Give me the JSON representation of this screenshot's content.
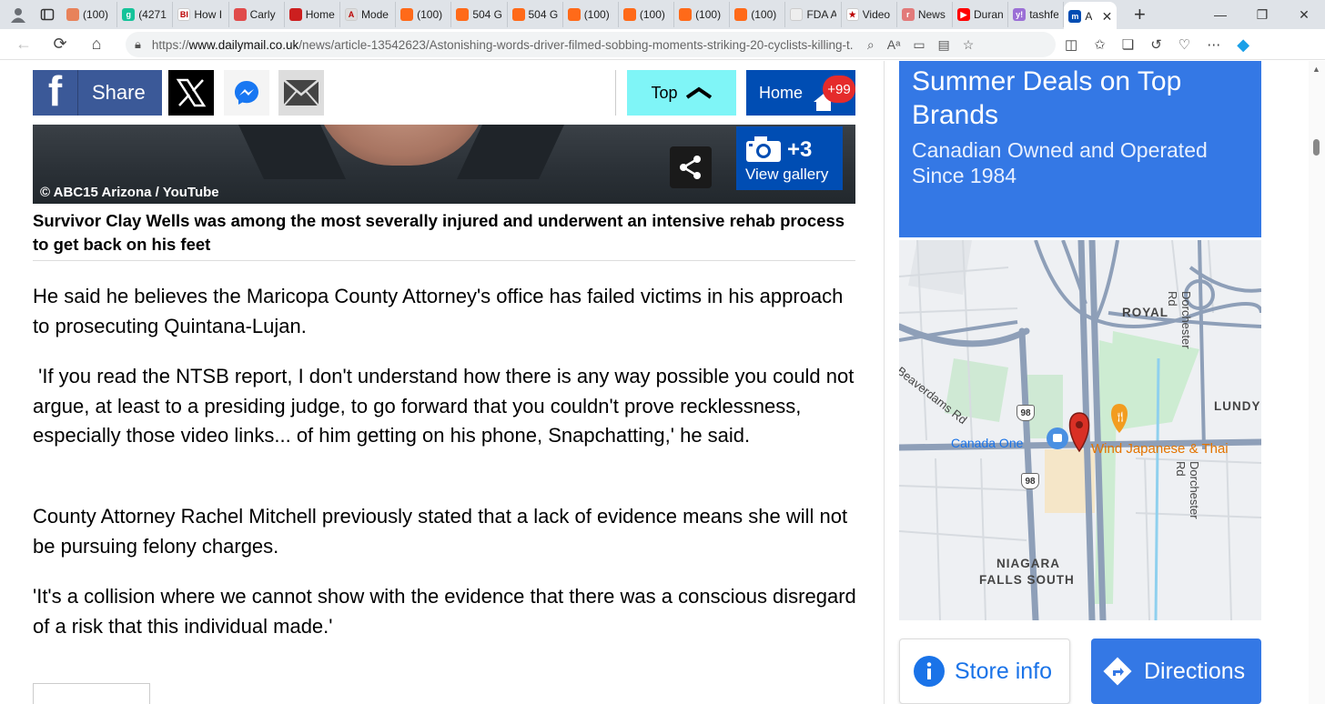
{
  "tabs": [
    {
      "title": "(100)",
      "color": "#e8825a",
      "glyph": ""
    },
    {
      "title": "(4271",
      "color": "#15c39a",
      "glyph": "g"
    },
    {
      "title": "How I",
      "color": "#ffffff",
      "glyph": "BI"
    },
    {
      "title": "Carly",
      "color": "#e04b4b",
      "glyph": ""
    },
    {
      "title": "Home",
      "color": "#cc1f1f",
      "glyph": ""
    },
    {
      "title": "Mode",
      "color": "#dddddd",
      "glyph": "A"
    },
    {
      "title": "(100)",
      "color": "#ff6a19",
      "glyph": ""
    },
    {
      "title": "504 G",
      "color": "#ff6a19",
      "glyph": ""
    },
    {
      "title": "504 G",
      "color": "#ff6a19",
      "glyph": ""
    },
    {
      "title": "(100)",
      "color": "#ff6a19",
      "glyph": ""
    },
    {
      "title": "(100)",
      "color": "#ff6a19",
      "glyph": ""
    },
    {
      "title": "(100)",
      "color": "#ff6a19",
      "glyph": ""
    },
    {
      "title": "(100)",
      "color": "#ff6a19",
      "glyph": ""
    },
    {
      "title": "FDA A",
      "color": "#eeeeee",
      "glyph": ""
    },
    {
      "title": "Video",
      "color": "#ffffff",
      "glyph": "★"
    },
    {
      "title": "News",
      "color": "#e27a7a",
      "glyph": "r"
    },
    {
      "title": "Duran",
      "color": "#ff0000",
      "glyph": "▶"
    },
    {
      "title": "tashfe",
      "color": "#9b6fd6",
      "glyph": "y!"
    }
  ],
  "active_tab": {
    "title": "A",
    "glyph": "m",
    "color": "#004db3"
  },
  "address": {
    "prefix": "https://",
    "domain": "www.dailymail.co.uk",
    "path": "/news/article-13542623/Astonishing-words-driver-filmed-sobbing-moments-striking-20-cyclists-killing-t..."
  },
  "sharebar": {
    "share_label": "Share",
    "top_label": "Top",
    "home_label": "Home",
    "home_badge": "+99"
  },
  "photo": {
    "credit": "© ABC15 Arizona / YouTube",
    "gallery_count": "+3",
    "gallery_label": "View gallery"
  },
  "caption": "Survivor Clay Wells was among the most severally injured and underwent an intensive rehab process to get back on his feet",
  "paragraphs": [
    "He said he believes the Maricopa County Attorney's office has failed victims in his approach to prosecuting Quintana-Lujan.",
    " 'If you read the NTSB report, I don't understand how there is any way possible you could not argue, at least to a presiding judge, to go forward that you couldn't prove recklessness, especially those video links... of him getting on his phone, Snapchatting,' he said.",
    "County Attorney Rachel Mitchell previously stated that a lack of evidence means she will not be pursuing felony charges.",
    "'It's a collision where we cannot show with the evidence that there was a conscious disregard of a risk that this individual made.'"
  ],
  "ad": {
    "title": "Summer Deals on Top Brands",
    "subtitle": "Canadian Owned and Operated Since 1984",
    "store_info": "Store info",
    "directions": "Directions",
    "map_labels": {
      "royal": "ROYAL",
      "beaverdams": "Beaverdams Rd",
      "dorchester_top": "Dorchester Rd",
      "dorchester_bottom": "Dorchester Rd",
      "lundy": "LUNDY",
      "canada_one": "Canada One",
      "wind": "Wind Japanese & Thai",
      "niagara": "NIAGARA",
      "falls_south": "FALLS SOUTH",
      "route_a": "98",
      "route_b": "98"
    }
  }
}
